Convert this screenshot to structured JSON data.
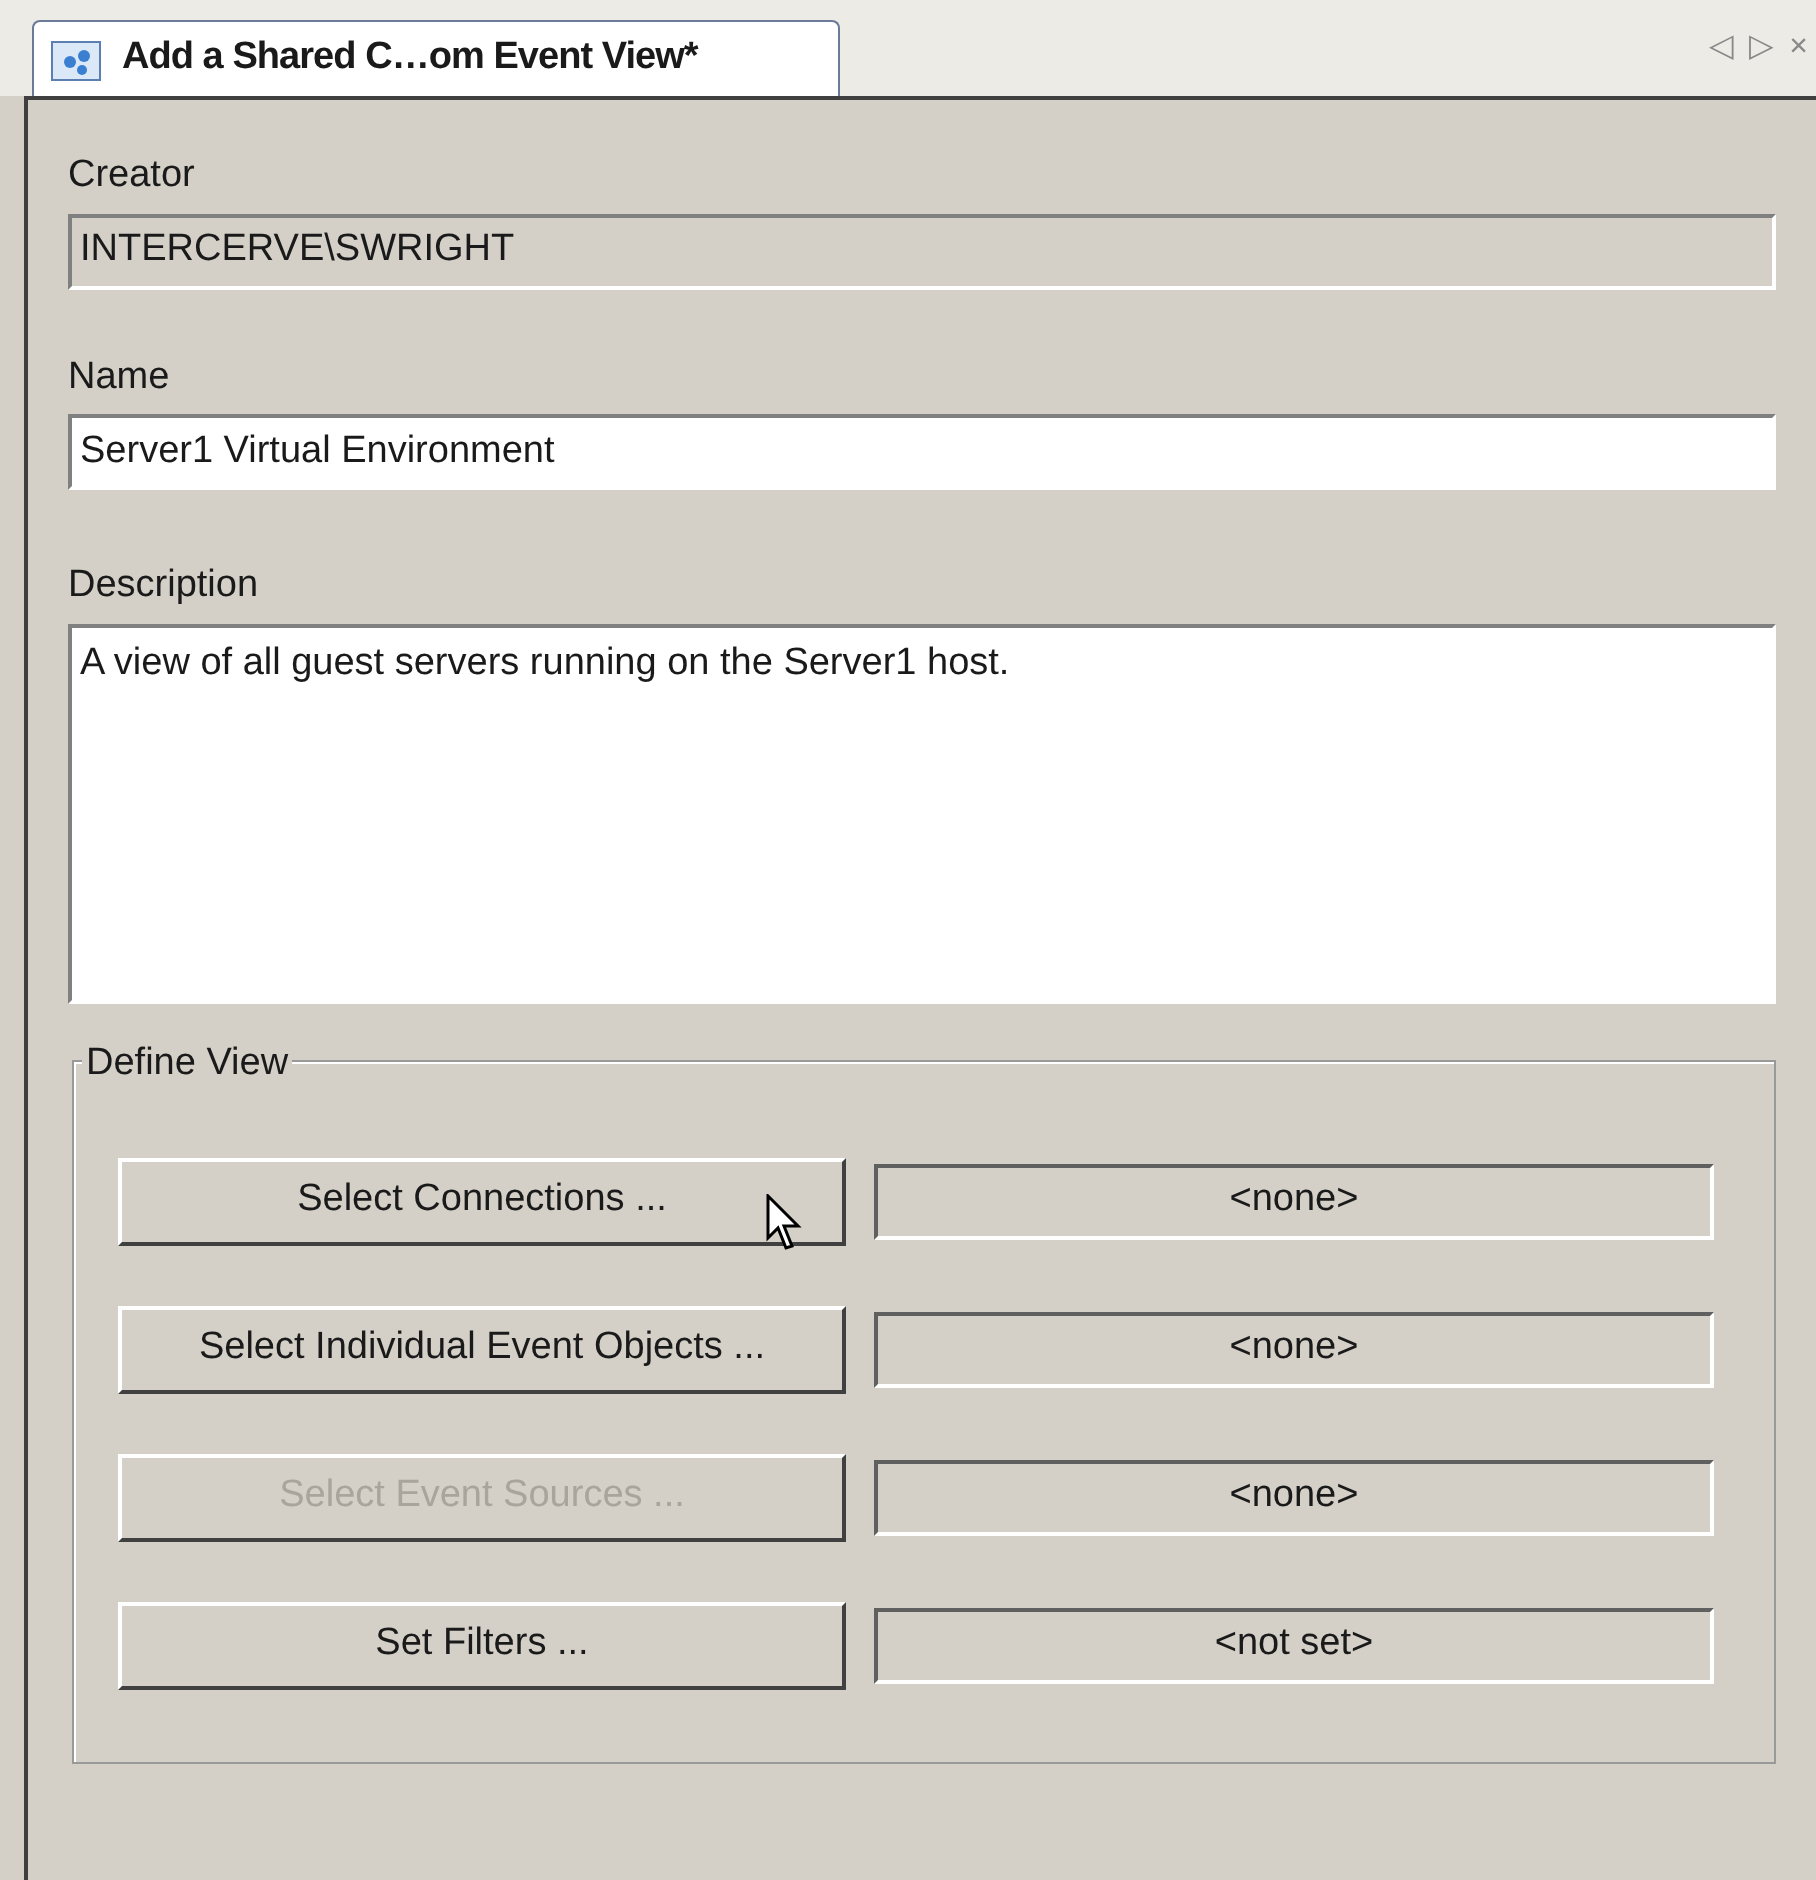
{
  "tab": {
    "title": "Add a Shared C…om Event View*"
  },
  "tab_controls": [
    "◁",
    "▷",
    "×"
  ],
  "creator": {
    "label": "Creator",
    "value": "INTERCERVE\\SWRIGHT",
    "disabled": true
  },
  "name": {
    "label": "Name",
    "value": "Server1 Virtual Environment"
  },
  "description": {
    "label": "Description",
    "value": "A view of all guest servers running on the Server1 host."
  },
  "define_view": {
    "title": "Define View",
    "rows": [
      {
        "button": "Select Connections ...",
        "disabled": false,
        "value": "<none>"
      },
      {
        "button": "Select Individual Event Objects ...",
        "disabled": false,
        "value": "<none>"
      },
      {
        "button": "Select Event Sources ...",
        "disabled": true,
        "value": "<none>"
      },
      {
        "button": "Set Filters ...",
        "disabled": false,
        "value": "<not set>"
      }
    ]
  }
}
